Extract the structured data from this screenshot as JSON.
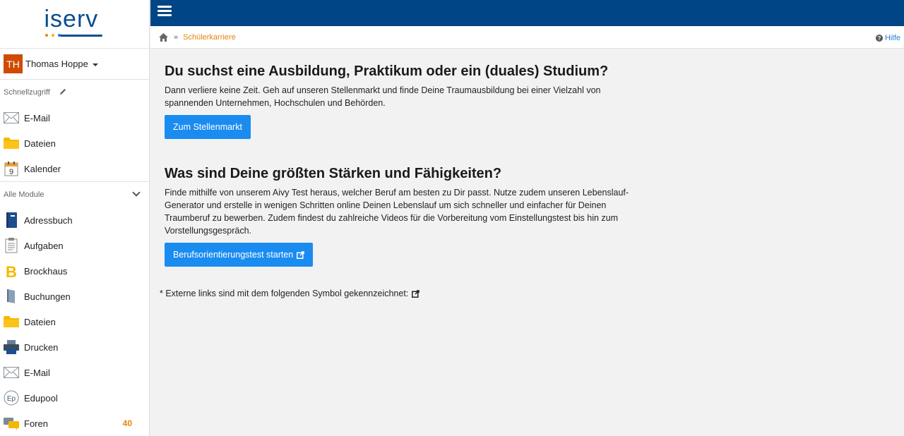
{
  "logo": {
    "text": "iserv"
  },
  "user": {
    "initials": "TH",
    "name": "Thomas Hoppe"
  },
  "sidebar": {
    "quick_access_label": "Schnellzugriff",
    "quick_items": [
      {
        "label": "E-Mail",
        "icon": "mail-icon"
      },
      {
        "label": "Dateien",
        "icon": "folder-icon"
      },
      {
        "label": "Kalender",
        "icon": "calendar-icon",
        "icon_text": "9"
      }
    ],
    "all_modules_label": "Alle Module",
    "modules": [
      {
        "label": "Adressbuch",
        "icon": "address-book-icon"
      },
      {
        "label": "Aufgaben",
        "icon": "clipboard-icon"
      },
      {
        "label": "Brockhaus",
        "icon": "brockhaus-icon",
        "icon_text": "B"
      },
      {
        "label": "Buchungen",
        "icon": "booking-icon"
      },
      {
        "label": "Dateien",
        "icon": "folder-icon"
      },
      {
        "label": "Drucken",
        "icon": "printer-icon"
      },
      {
        "label": "E-Mail",
        "icon": "mail-icon"
      },
      {
        "label": "Edupool",
        "icon": "edupool-icon",
        "icon_text": "Ep"
      },
      {
        "label": "Foren",
        "icon": "forum-icon",
        "badge": "40"
      }
    ]
  },
  "breadcrumb": {
    "separator": "»",
    "current": "Schülerkarriere"
  },
  "help": {
    "label": "Hilfe",
    "icon_text": "?"
  },
  "main": {
    "section1": {
      "title": "Du suchst eine Ausbildung, Praktikum oder ein (duales) Studium?",
      "text_line1": "Dann verliere keine Zeit. Geh auf unseren Stellenmarkt und finde Deine Traumausbildung bei einer Vielzahl von",
      "text_line2": "spannenden Unternehmen, Hochschulen und Behörden.",
      "button": "Zum Stellenmarkt"
    },
    "section2": {
      "title": "Was sind Deine größten Stärken und Fähigkeiten?",
      "text_line1": "Finde mithilfe von unserem Aivy Test heraus, welcher Beruf am besten zu Dir passt. Nutze zudem unseren Lebenslauf-",
      "text_line2": "Generator und erstelle in wenigen Schritten online Deinen Lebenslauf um sich schneller und einfacher für Deinen",
      "text_line3": "Traumberuf zu bewerben. Zudem findest du zahlreiche Videos für die Vorbereitung vom Einstellungstest bis hin zum",
      "text_line4": "Vorstellungsgespräch.",
      "button": "Berufsorientierungstest starten"
    },
    "note": "* Externe links sind mit dem folgenden Symbol gekennzeichnet:"
  },
  "colors": {
    "topbar": "#004585",
    "accent_orange": "#e8830c",
    "button_blue": "#1a8cf0",
    "avatar": "#d04a02"
  }
}
